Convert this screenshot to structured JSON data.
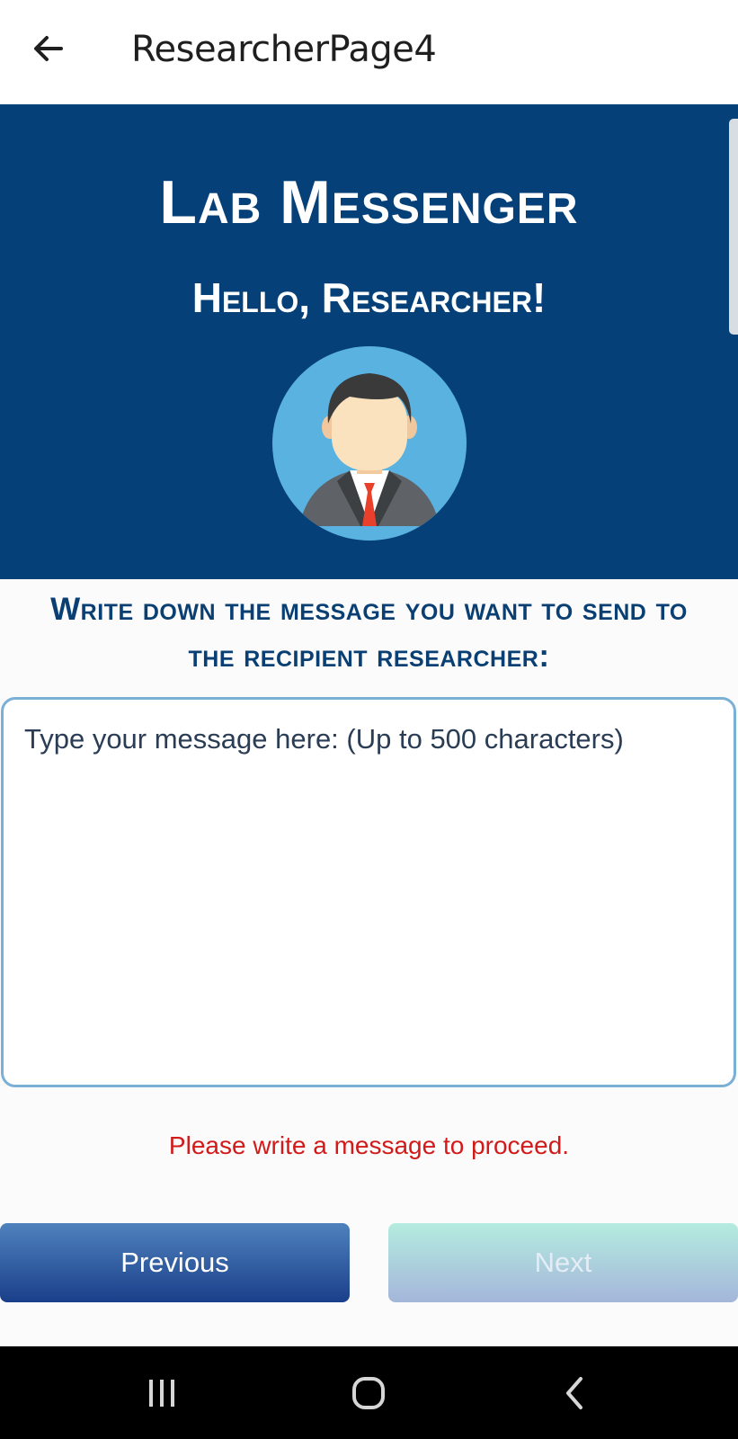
{
  "header": {
    "back_icon": "arrow-left-icon",
    "title": "ResearcherPage4"
  },
  "banner": {
    "app_title": "Lab Messenger",
    "greeting": "Hello, Researcher!",
    "avatar_icon": "researcher-avatar-icon",
    "background_color": "#064079"
  },
  "form": {
    "prompt": "Write down the message you want to send to the recipient researcher:",
    "message_value": "",
    "message_placeholder": "Type your message here: (Up to 500 characters)",
    "error_text": "Please write a message to proceed."
  },
  "actions": {
    "previous_label": "Previous",
    "next_label": "Next"
  },
  "system_nav": {
    "recents_icon": "recents-icon",
    "home_icon": "home-icon",
    "back_icon": "chevron-left-icon"
  },
  "colors": {
    "accent": "#0a3f73",
    "error": "#d11a1a"
  }
}
